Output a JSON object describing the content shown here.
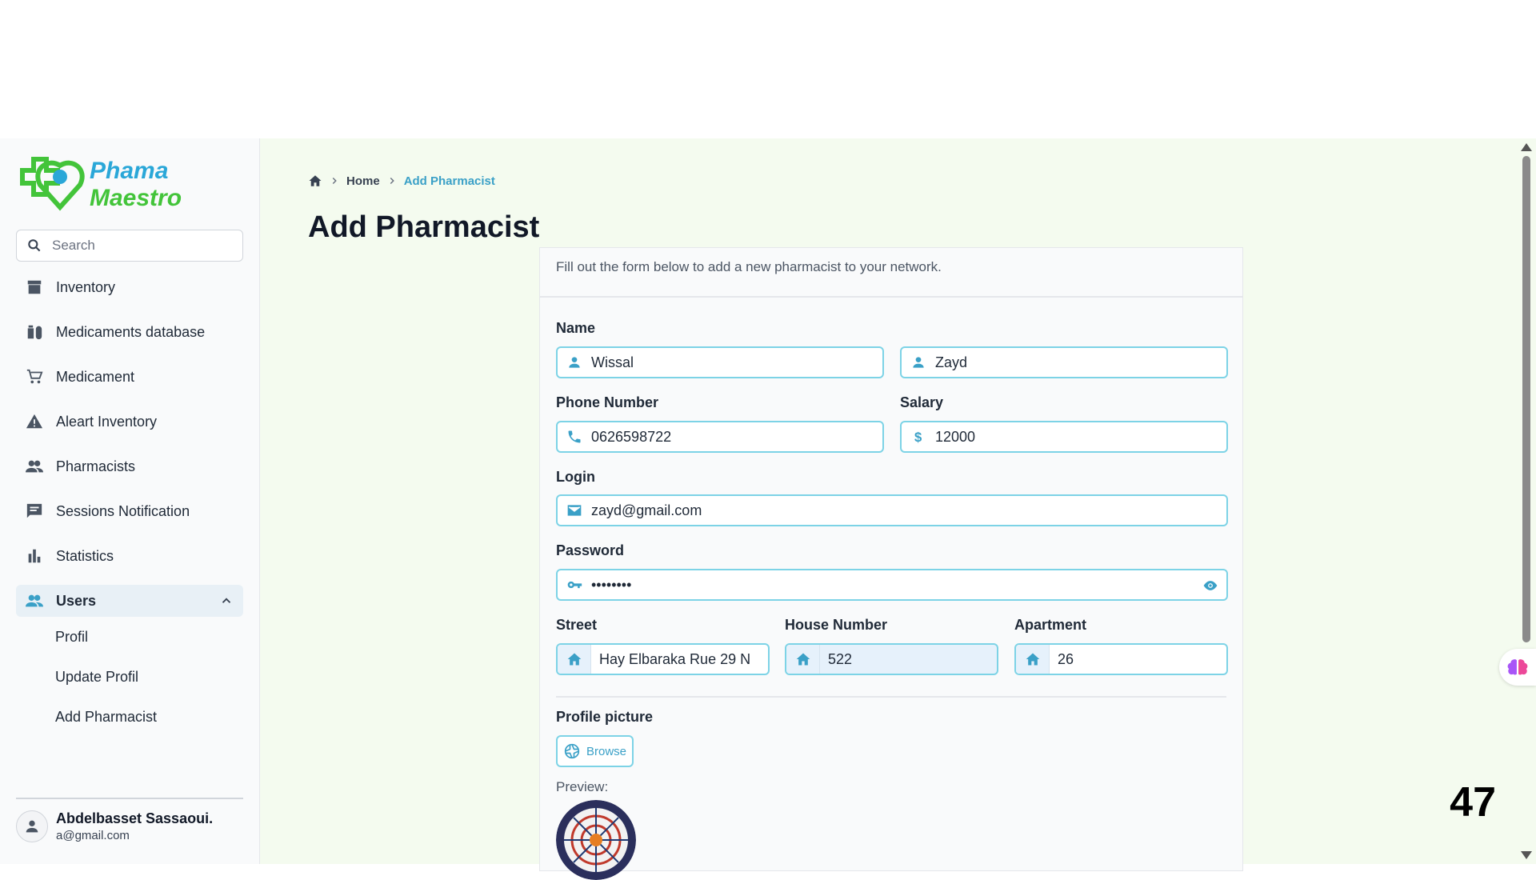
{
  "brand": {
    "line1": "Phama",
    "line2": "Maestro",
    "color_primary": "#43c43a",
    "color_accent": "#2aa7d8"
  },
  "search": {
    "placeholder": "Search"
  },
  "sidebar": {
    "items": [
      {
        "label": "Inventory",
        "icon": "archive-icon"
      },
      {
        "label": "Medicaments database",
        "icon": "medication-icon"
      },
      {
        "label": "Medicament",
        "icon": "cart-icon"
      },
      {
        "label": "Aleart Inventory",
        "icon": "warning-icon"
      },
      {
        "label": "Pharmacists",
        "icon": "people-icon"
      },
      {
        "label": "Sessions Notification",
        "icon": "chat-icon"
      },
      {
        "label": "Statistics",
        "icon": "bar-chart-icon"
      }
    ],
    "active": {
      "label": "Users",
      "icon": "people-icon"
    },
    "sub_items": [
      "Profil",
      "Update Profil",
      "Add Pharmacist"
    ]
  },
  "user": {
    "name": "Abdelbasset Sassaoui.",
    "email": "a@gmail.com"
  },
  "breadcrumb": {
    "home": "Home",
    "current": "Add Pharmacist"
  },
  "page": {
    "title": "Add Pharmacist",
    "description": "Fill out the form below to add a new pharmacist to your network."
  },
  "form": {
    "name_label": "Name",
    "first_name": "Wissal",
    "last_name": "Zayd",
    "phone_label": "Phone Number",
    "phone": "0626598722",
    "salary_label": "Salary",
    "salary": "12000",
    "login_label": "Login",
    "login": "zayd@gmail.com",
    "password_label": "Password",
    "password": "••••••••",
    "street_label": "Street",
    "street": "Hay Elbaraka Rue 29 N",
    "house_label": "House Number",
    "house": "522",
    "apartment_label": "Apartment",
    "apartment": "26",
    "picture_label": "Profile picture",
    "browse_label": "Browse",
    "preview_label": "Preview:"
  },
  "overlay": {
    "number": "47"
  },
  "colors": {
    "accent": "#3aa0c7",
    "main_bg": "#f4fbef",
    "border": "#7dd3e6"
  }
}
